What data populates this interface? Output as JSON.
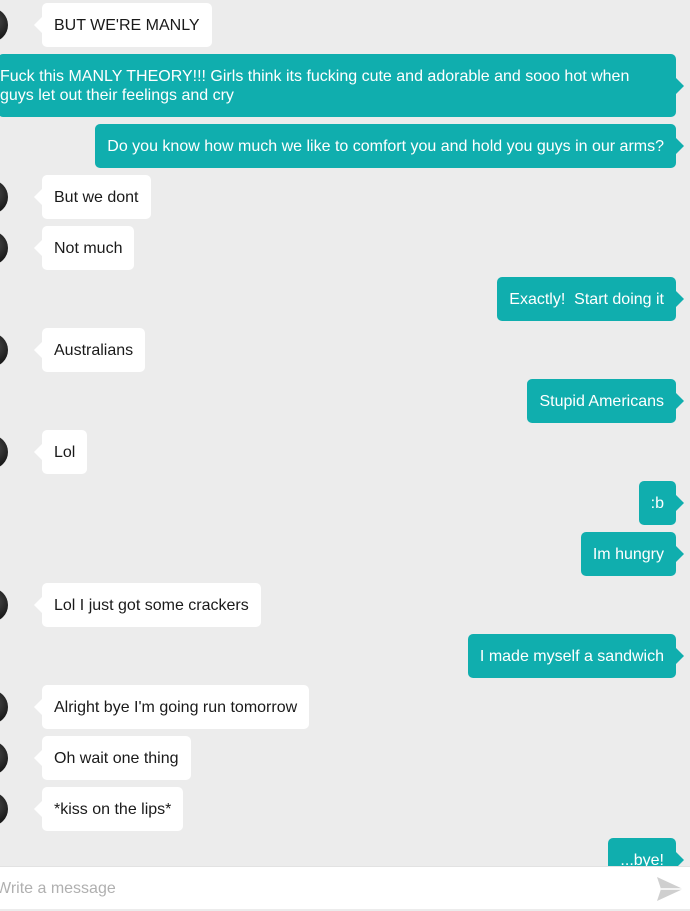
{
  "colors": {
    "outgoing": "#10aeae",
    "incoming": "#ffffff",
    "background": "#ececec"
  },
  "messages": [
    {
      "dir": "in",
      "text": "BUT WE'RE MANLY"
    },
    {
      "dir": "out",
      "text": "Fuck this MANLY THEORY!!! Girls think its fucking cute and adorable and sooo hot when guys let out their feelings and cry"
    },
    {
      "dir": "out",
      "text": "Do you know how much we like to comfort you and hold you guys in our arms?"
    },
    {
      "dir": "in",
      "text": "But we dont"
    },
    {
      "dir": "in",
      "text": "Not much"
    },
    {
      "dir": "out",
      "text": "Exactly!  Start doing it"
    },
    {
      "dir": "in",
      "text": "Australians"
    },
    {
      "dir": "out",
      "text": "Stupid Americans"
    },
    {
      "dir": "in",
      "text": "Lol"
    },
    {
      "dir": "out",
      "text": ":b"
    },
    {
      "dir": "out",
      "text": "Im hungry"
    },
    {
      "dir": "in",
      "text": "Lol I just got some crackers"
    },
    {
      "dir": "out",
      "text": "I made myself a sandwich"
    },
    {
      "dir": "in",
      "text": "Alright bye I'm going run tomorrow"
    },
    {
      "dir": "in",
      "text": "Oh wait one thing"
    },
    {
      "dir": "in",
      "text": "*kiss on the lips*"
    },
    {
      "dir": "out",
      "text": "...bye!"
    }
  ],
  "composer": {
    "placeholder": "Write a message",
    "send_icon": "send-icon"
  }
}
